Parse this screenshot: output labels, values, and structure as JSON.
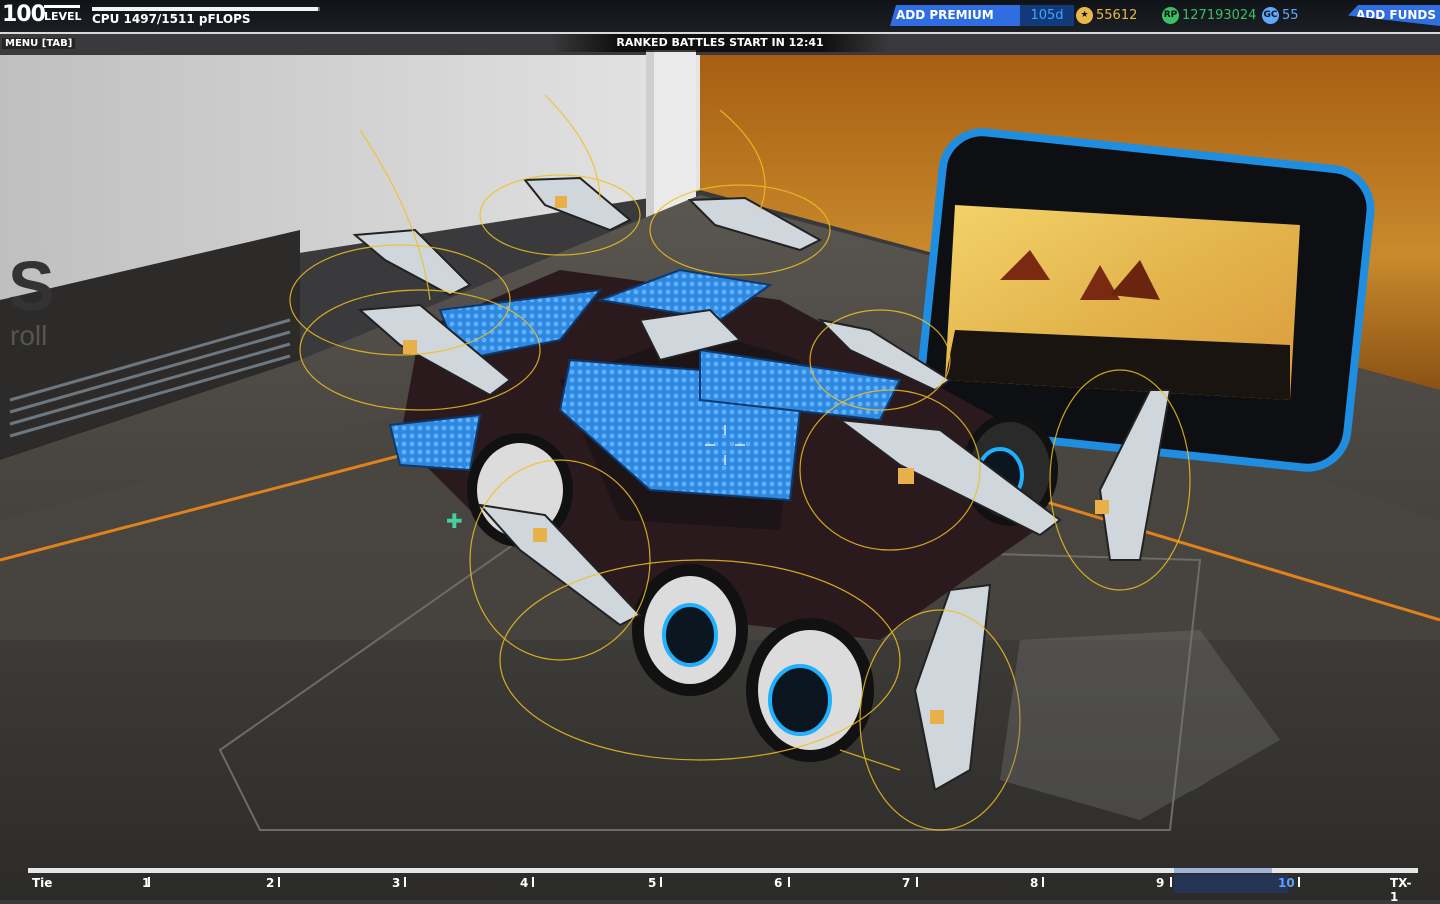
{
  "player": {
    "level_number": "100",
    "level_word": "LEVEL"
  },
  "cpu": {
    "label": "CPU 1497/1511 pFLOPS",
    "used": 1497,
    "max": 1511
  },
  "menu": {
    "label": "MENU [TAB]"
  },
  "banner": {
    "text": "RANKED BATTLES START IN 12:41"
  },
  "premium": {
    "button": "ADD PREMIUM",
    "days": "105d"
  },
  "currencies": [
    {
      "name": "tech-points",
      "value": "55612",
      "color": "#e8b84a",
      "icon": "star-icon"
    },
    {
      "name": "robits",
      "value": "127193024",
      "color": "#3bbf63",
      "icon": "rp-icon"
    },
    {
      "name": "galaxy-coins",
      "value": "55",
      "color": "#5fa8ff",
      "icon": "gc-icon"
    }
  ],
  "funds": {
    "button": "ADD FUNDS"
  },
  "tiers": {
    "labels": [
      "Tie",
      "1",
      "2",
      "3",
      "4",
      "5",
      "6",
      "7",
      "8",
      "9",
      "10",
      "TX-1"
    ],
    "current_index": 10
  },
  "backdrop": {
    "logo_text": "roll",
    "logo_letter": "S"
  },
  "colors": {
    "accent_blue": "#2f6de0",
    "orange_wall": "#b5711b",
    "hud_dark": "#14181c"
  }
}
